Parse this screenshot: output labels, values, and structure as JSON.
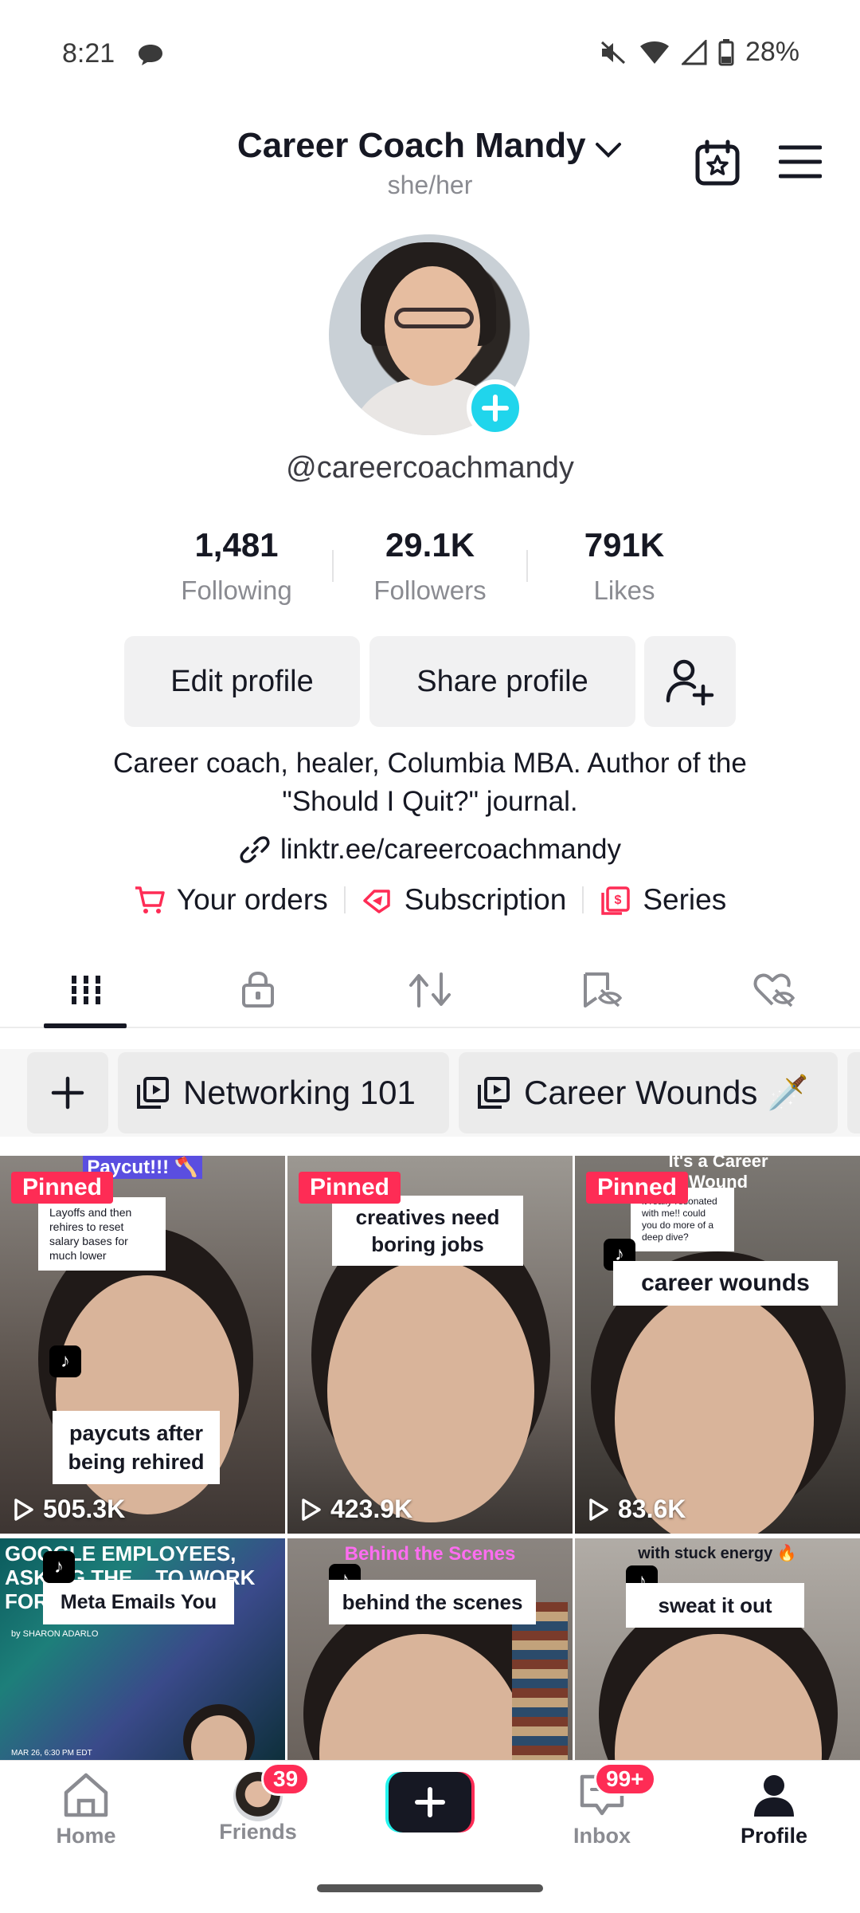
{
  "status_bar": {
    "time": "8:21",
    "battery": "28%"
  },
  "header": {
    "display_name": "Career Coach Mandy",
    "pronouns": "she/her"
  },
  "profile": {
    "username": "@careercoachmandy",
    "stats": [
      {
        "value": "1,481",
        "label": "Following"
      },
      {
        "value": "29.1K",
        "label": "Followers"
      },
      {
        "value": "791K",
        "label": "Likes"
      }
    ],
    "buttons": {
      "edit": "Edit profile",
      "share": "Share profile"
    },
    "bio_line1": "Career coach, healer, Columbia MBA. Author of the",
    "bio_line2": "\"Should I Quit?\" journal.",
    "link": "linktr.ee/careercoachmandy",
    "services": [
      {
        "label": "Your orders",
        "icon": "cart-icon"
      },
      {
        "label": "Subscription",
        "icon": "subscription-icon"
      },
      {
        "label": "Series",
        "icon": "series-icon"
      }
    ]
  },
  "tabs": [
    "videos-grid-icon",
    "lock-icon",
    "repost-icon",
    "saved-icon",
    "liked-icon"
  ],
  "playlists": [
    {
      "label": "Networking 101"
    },
    {
      "label": "Career Wounds 🗡️"
    }
  ],
  "videos": [
    {
      "pinned": "Pinned",
      "top_text": "Paycut!!! 🪓",
      "comment": "Layoffs and then rehires to reset salary bases for much lower",
      "caption": "paycuts after being rehired",
      "views": "505.3K"
    },
    {
      "pinned": "Pinned",
      "top_text": "",
      "comment": "",
      "caption": "creatives need boring jobs",
      "views": "423.9K"
    },
    {
      "pinned": "Pinned",
      "top_text": "It's a Career Wound",
      "comment": "it really resonated with me!! could you do more of a deep dive?",
      "caption": "career wounds",
      "views": "83.6K"
    },
    {
      "top_text": "GOOGLE EMPLOYEES, ASKING THE... TO WORK FOR FAC...",
      "caption": "Meta Emails You",
      "byline": "by SHARON ADARLO",
      "dateline": "MAR 26, 6:30 PM EDT"
    },
    {
      "top_text": "Behind the Scenes",
      "caption": "behind the scenes"
    },
    {
      "top_text": "with stuck energy 🔥",
      "caption": "sweat it out"
    }
  ],
  "bottom_nav": {
    "home": "Home",
    "friends": "Friends",
    "friends_badge": "39",
    "inbox": "Inbox",
    "inbox_badge": "99+",
    "profile": "Profile"
  },
  "colors": {
    "accent": "#fe2c55",
    "cyan": "#20d5ec",
    "text": "#161823",
    "muted": "#8a8b91"
  }
}
